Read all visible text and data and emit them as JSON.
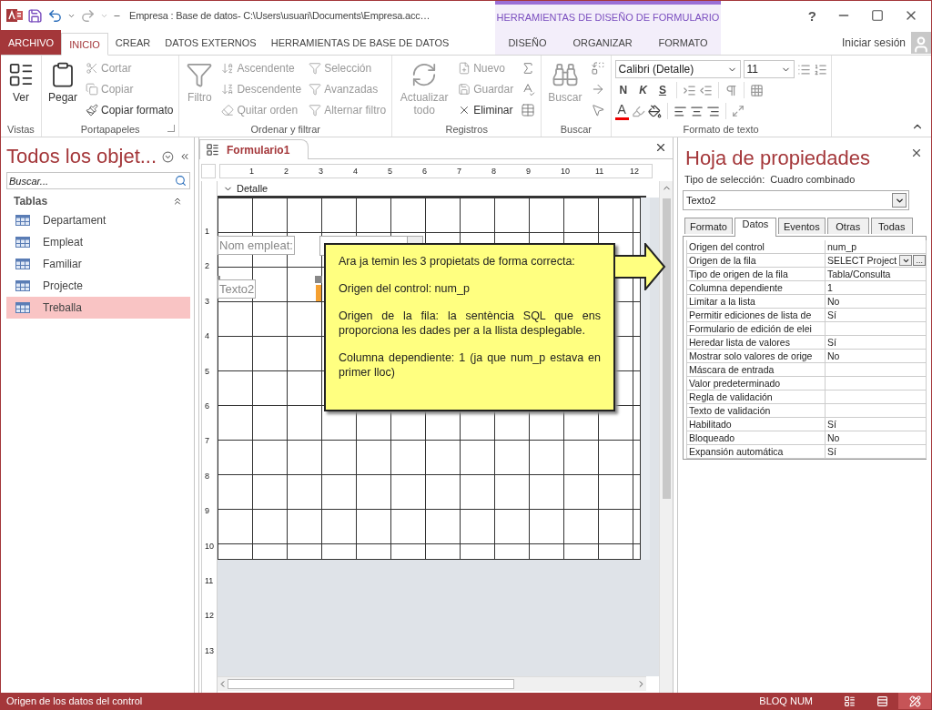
{
  "title_bar": {
    "title": "Empresa : Base de datos- C:\\Users\\usuari\\Documents\\Empresa.acc…",
    "context_title": "HERRAMIENTAS DE DISEÑO DE FORMULARIO",
    "help": "?"
  },
  "ribbon_tabs": [
    {
      "label": "ARCHIVO",
      "kind": "file",
      "selected": false
    },
    {
      "label": "INICIO",
      "kind": "tab",
      "selected": true
    },
    {
      "label": "CREAR",
      "kind": "tab",
      "selected": false
    },
    {
      "label": "DATOS EXTERNOS",
      "kind": "tab",
      "selected": false
    },
    {
      "label": "HERRAMIENTAS DE BASE DE DATOS",
      "kind": "tab",
      "selected": false
    },
    {
      "label": "DISEÑO",
      "kind": "context",
      "selected": false
    },
    {
      "label": "ORGANIZAR",
      "kind": "context",
      "selected": false
    },
    {
      "label": "FORMATO",
      "kind": "context",
      "selected": false
    }
  ],
  "account": {
    "label": "Iniciar sesión"
  },
  "ribbon_groups": [
    {
      "label": "Vistas",
      "items": [
        {
          "label": "Ver",
          "kind": "large",
          "disabled": false
        }
      ]
    },
    {
      "label": "Portapapeles",
      "items": [
        {
          "label": "Pegar",
          "kind": "large",
          "disabled": false
        },
        {
          "label": "Cortar",
          "kind": "small",
          "disabled": true
        },
        {
          "label": "Copiar",
          "kind": "small",
          "disabled": true
        },
        {
          "label": "Copiar formato",
          "kind": "small",
          "disabled": false
        }
      ]
    },
    {
      "label": "Ordenar y filtrar",
      "items": [
        {
          "label": "Filtro",
          "kind": "large",
          "disabled": true
        },
        {
          "label": "Ascendente",
          "kind": "small",
          "disabled": true
        },
        {
          "label": "Descendente",
          "kind": "small",
          "disabled": true
        },
        {
          "label": "Quitar orden",
          "kind": "small",
          "disabled": true
        },
        {
          "label": "Selección",
          "kind": "small",
          "disabled": true
        },
        {
          "label": "Avanzadas",
          "kind": "small",
          "disabled": true
        },
        {
          "label": "Alternar filtro",
          "kind": "small",
          "disabled": true
        }
      ]
    },
    {
      "label": "Registros",
      "items": [
        {
          "label": "Actualizar todo",
          "kind": "large",
          "disabled": true
        },
        {
          "label": "Nuevo",
          "kind": "small",
          "disabled": true
        },
        {
          "label": "Guardar",
          "kind": "small",
          "disabled": true
        },
        {
          "label": "Eliminar",
          "kind": "small",
          "disabled": false
        }
      ]
    },
    {
      "label": "Buscar",
      "items": [
        {
          "label": "Buscar",
          "kind": "large",
          "disabled": true
        }
      ]
    },
    {
      "label": "Formato de texto"
    }
  ],
  "text_format": {
    "font": "Calibri (Detalle)",
    "size": "11",
    "styles": [
      "N",
      "K",
      "S"
    ],
    "font_color": "A"
  },
  "nav_pane": {
    "title": "Todos los objet...",
    "search": {
      "placeholder": "Buscar..."
    },
    "group": "Tablas",
    "items": [
      {
        "label": "Departament",
        "selected": false
      },
      {
        "label": "Empleat",
        "selected": false
      },
      {
        "label": "Familiar",
        "selected": false
      },
      {
        "label": "Projecte",
        "selected": false
      },
      {
        "label": "Treballa",
        "selected": true
      }
    ]
  },
  "document": {
    "tab": "Formulario1",
    "section": "Detalle",
    "ruler_h": [
      "1",
      "2",
      "3",
      "4",
      "5",
      "6",
      "7",
      "8",
      "9",
      "10",
      "11",
      "12"
    ],
    "ruler_v": [
      "1",
      "2",
      "3",
      "4",
      "5",
      "6",
      "7",
      "8",
      "9",
      "10",
      "11",
      "12",
      "13"
    ],
    "controls": [
      {
        "kind": "label",
        "text": "Nom empleat:"
      },
      {
        "kind": "combo"
      },
      {
        "kind": "label",
        "text": "Texto2"
      }
    ],
    "callout": [
      "Ara ja temin les 3 propietats de forma correcta:",
      "Origen del control: num_p",
      "Origen de la fila: la sentència SQL que ens proporciona les dades per a la llista desplegable.",
      "Columna dependiente: 1 (ja que num_p estava en primer lloc)"
    ]
  },
  "property_sheet": {
    "title": "Hoja de propiedades",
    "selection_type": "Tipo de selección:  Cuadro combinado",
    "object": "Texto2",
    "tabs": [
      {
        "label": "Formato",
        "selected": false
      },
      {
        "label": "Datos",
        "selected": true
      },
      {
        "label": "Eventos",
        "selected": false
      },
      {
        "label": "Otras",
        "selected": false
      },
      {
        "label": "Todas",
        "selected": false
      }
    ],
    "rows": [
      {
        "name": "Origen del control",
        "value": "num_p",
        "kind": "text"
      },
      {
        "name": "Origen de la fila",
        "value": "SELECT Project",
        "kind": "builder",
        "builder": "..."
      },
      {
        "name": "Tipo de origen de la fila",
        "value": "Tabla/Consulta",
        "kind": "text"
      },
      {
        "name": "Columna dependiente",
        "value": "1",
        "kind": "text"
      },
      {
        "name": "Limitar a la lista",
        "value": "No",
        "kind": "text"
      },
      {
        "name": "Permitir ediciones de lista de",
        "value": "Sí",
        "kind": "text"
      },
      {
        "name": "Formulario de edición de elei",
        "kind": "text"
      },
      {
        "name": "Heredar lista de valores",
        "value": "Sí",
        "kind": "text"
      },
      {
        "name": "Mostrar solo valores de orige",
        "value": "No",
        "kind": "text"
      },
      {
        "name": "Máscara de entrada",
        "kind": "text"
      },
      {
        "name": "Valor predeterminado",
        "kind": "text"
      },
      {
        "name": "Regla de validación",
        "kind": "text"
      },
      {
        "name": "Texto de validación",
        "kind": "text"
      },
      {
        "name": "Habilitado",
        "value": "Sí",
        "kind": "text"
      },
      {
        "name": "Bloqueado",
        "value": "No",
        "kind": "text"
      },
      {
        "name": "Expansión automática",
        "value": "Sí",
        "kind": "text"
      }
    ]
  },
  "status_bar": {
    "text": "Origen de los datos del control",
    "num_lock": "BLOQ NUM",
    "views": [
      {
        "selected": false
      },
      {
        "selected": false
      },
      {
        "selected": true
      }
    ]
  }
}
